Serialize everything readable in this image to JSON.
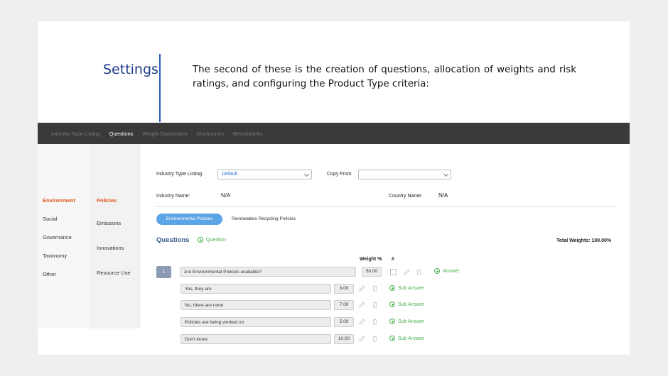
{
  "slide": {
    "title": "Settings",
    "description": "The second of these is the creation of questions, allocation of weights and risk ratings, and configuring the Product Type criteria:"
  },
  "topnav": {
    "items": [
      "Industry Type Listing",
      "Questions",
      "Weight Distribution",
      "Disclosures",
      "Benchmarks"
    ],
    "active_index": 1
  },
  "categories": [
    "Environment",
    "Social",
    "Governance",
    "Taxonomy",
    "Other"
  ],
  "subcategories": [
    "Policies",
    "Emissions",
    "Innovations",
    "Resource Use"
  ],
  "form": {
    "industry_type_label": "Industry Type Listing:",
    "industry_type_value": "Default",
    "copy_from_label": "Copy From",
    "copy_from_value": "",
    "industry_name_label": "Industry Name:",
    "industry_name_value": "N/A",
    "country_name_label": "Country Name:",
    "country_name_value": "N/A"
  },
  "policy_tabs": [
    "Environmental Policies",
    "Renewables Recycling Policies"
  ],
  "questions": {
    "heading": "Questions",
    "add_label": "Question",
    "total_weights": "Total Weights: 100.00%",
    "weight_header": "Weight %",
    "hash_header": "#",
    "items": [
      {
        "number": "1",
        "text": "Are Environmental Policies available?",
        "weight": "50.00",
        "add_answer_label": "Answer",
        "answers": [
          {
            "text": "Yes, they are",
            "weight": "3.00",
            "add_label": "Sub Answer"
          },
          {
            "text": "No, there are none",
            "weight": "7.00",
            "add_label": "Sub Answer"
          },
          {
            "text": "Policies are being worked on",
            "weight": "5.00",
            "add_label": "Sub Answer"
          },
          {
            "text": "Don't know",
            "weight": "10.00",
            "add_label": "Sub Answer"
          }
        ]
      }
    ]
  },
  "colors": {
    "accent_orange": "#e0531c",
    "accent_blue": "#5ba4e6",
    "add_green": "#4caf50",
    "nav_bg": "#3a3a3a",
    "title_blue": "#1f3a8a"
  }
}
